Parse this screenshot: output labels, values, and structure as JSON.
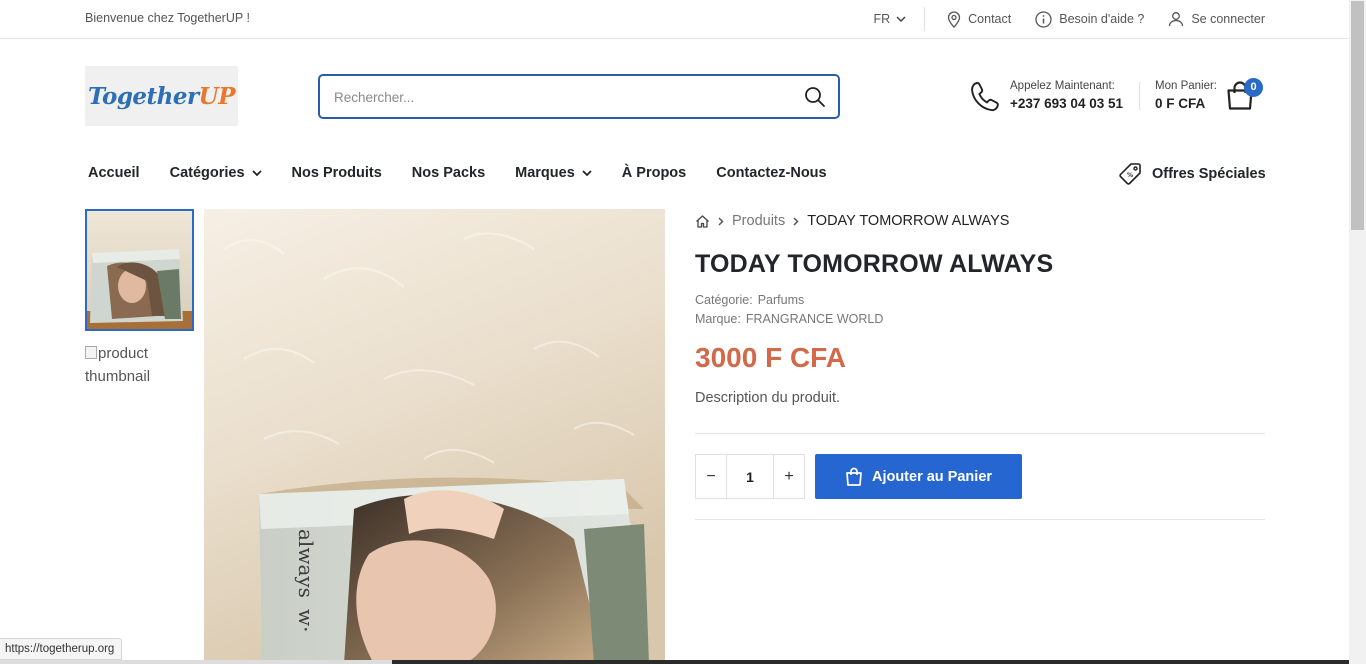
{
  "topbar": {
    "welcome": "Bienvenue chez TogetherUP !",
    "language": "FR",
    "contact": "Contact",
    "help": "Besoin d'aide ?",
    "login": "Se connecter"
  },
  "header": {
    "logo_text_part1": "Together",
    "logo_text_part2": "UP",
    "search_placeholder": "Rechercher...",
    "call_label": "Appelez Maintenant:",
    "call_number": "+237 693 04 03 51",
    "cart_label": "Mon Panier:",
    "cart_total": "0 F CFA",
    "cart_count": "0"
  },
  "nav": {
    "items": [
      {
        "label": "Accueil",
        "dropdown": false
      },
      {
        "label": "Catégories",
        "dropdown": true
      },
      {
        "label": "Nos Produits",
        "dropdown": false
      },
      {
        "label": "Nos Packs",
        "dropdown": false
      },
      {
        "label": "Marques",
        "dropdown": true
      },
      {
        "label": "À Propos",
        "dropdown": false
      },
      {
        "label": "Contactez-Nous",
        "dropdown": false
      }
    ],
    "special_offers": "Offres Spéciales"
  },
  "gallery": {
    "broken_thumb_alt": "product thumbnail"
  },
  "product": {
    "breadcrumb_products": "Produits",
    "breadcrumb_current": "TODAY TOMORROW ALWAYS",
    "title": "TODAY TOMORROW ALWAYS",
    "category_label": "Catégorie:",
    "category_value": "Parfums",
    "brand_label": "Marque:",
    "brand_value": "FRANGRANCE WORLD",
    "price": "3000 F CFA",
    "description": "Description du produit.",
    "quantity": "1",
    "add_to_cart": "Ajouter au Panier"
  },
  "status": {
    "url": "https://togetherup.org"
  },
  "colors": {
    "accent_blue": "#2566d0",
    "price_orange": "#d2694a",
    "logo_blue": "#2d6fb7",
    "logo_orange": "#e8782c"
  }
}
